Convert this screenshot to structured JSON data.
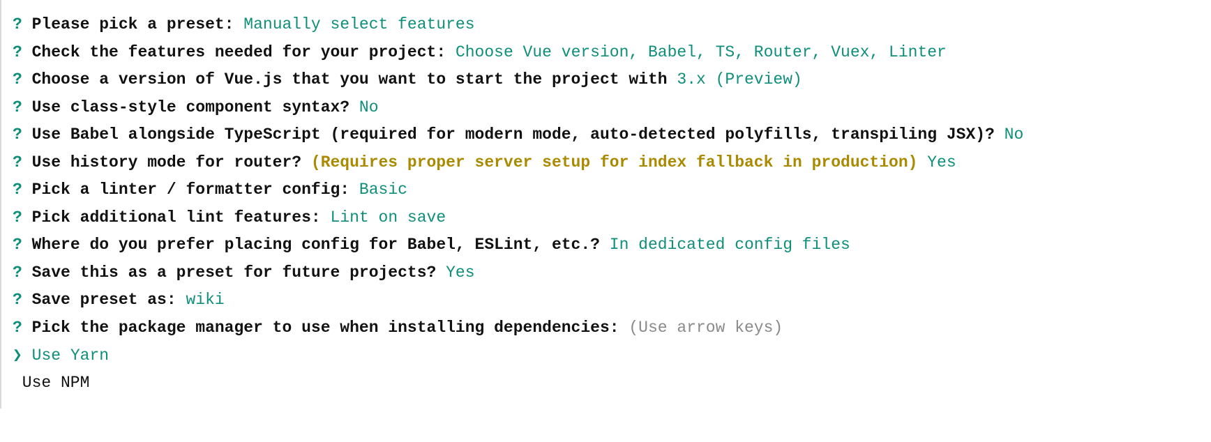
{
  "prompts": [
    {
      "marker": "?",
      "question": "Please pick a preset: ",
      "answer": "Manually select features"
    },
    {
      "marker": "?",
      "question": "Check the features needed for your project: ",
      "answer": "Choose Vue version, Babel, TS, Router, Vuex, Linter"
    },
    {
      "marker": "?",
      "question": "Choose a version of Vue.js that you want to start the project with ",
      "answer": "3.x (Preview)"
    },
    {
      "marker": "?",
      "question": "Use class-style component syntax? ",
      "answer": "No"
    },
    {
      "marker": "?",
      "question": "Use Babel alongside TypeScript (required for modern mode, auto-detected polyfills, transpiling JSX)? ",
      "answer": "No"
    },
    {
      "marker": "?",
      "question": "Use history mode for router? ",
      "note": "(Requires proper server setup for index fallback in production) ",
      "answer": "Yes"
    },
    {
      "marker": "?",
      "question": "Pick a linter / formatter config: ",
      "answer": "Basic"
    },
    {
      "marker": "?",
      "question": "Pick additional lint features: ",
      "answer": "Lint on save"
    },
    {
      "marker": "?",
      "question": "Where do you prefer placing config for Babel, ESLint, etc.? ",
      "answer": "In dedicated config files"
    },
    {
      "marker": "?",
      "question": "Save this as a preset for future projects? ",
      "answer": "Yes"
    },
    {
      "marker": "?",
      "question": "Save preset as: ",
      "answer": "wiki"
    }
  ],
  "active": {
    "marker": "?",
    "question": "Pick the package manager to use when installing dependencies: ",
    "hint": "(Use arrow keys)",
    "cursor": "❯",
    "options": [
      {
        "label": "Use Yarn",
        "selected": true
      },
      {
        "label": "Use NPM",
        "selected": false
      }
    ]
  }
}
